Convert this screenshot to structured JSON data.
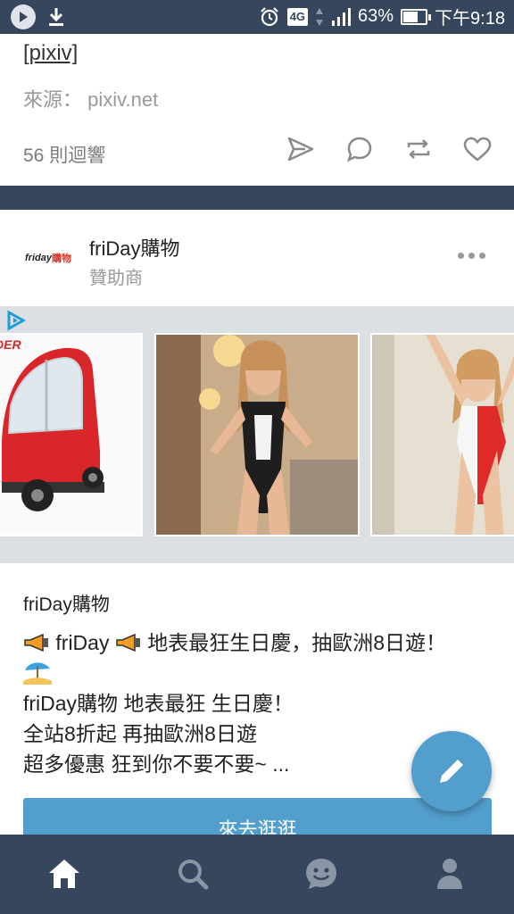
{
  "status_bar": {
    "network": "4G",
    "battery": "63%",
    "time": "下午9:18",
    "battery_level": 0.63
  },
  "post": {
    "link_text": "[pixiv]",
    "source_label": "來源：",
    "source_value": "pixiv.net",
    "notes": "56 則迴響"
  },
  "ad": {
    "advertiser": "friDay購物",
    "sponsor_label": "贊助商",
    "logo_text_fr": "friday",
    "logo_text_sh": "購物",
    "slide1_banner": "DER",
    "brand": "friDay購物",
    "line1_a": "friDay",
    "line1_b": "地表最狂生日慶，抽歐洲8日遊！",
    "line2": "friDay購物 地表最狂 生日慶！",
    "line3": "全站8折起 再抽歐洲8日遊",
    "line4": "超多優惠 狂到你不要不要~ ...",
    "cta": "來去逛逛"
  },
  "colors": {
    "navy": "#36465d",
    "accent": "#529ecc"
  },
  "icons": {
    "actions": [
      "share-icon",
      "reply-icon",
      "reblog-icon",
      "like-icon"
    ],
    "nav": [
      "home-icon",
      "search-icon",
      "activity-icon",
      "account-icon"
    ]
  }
}
